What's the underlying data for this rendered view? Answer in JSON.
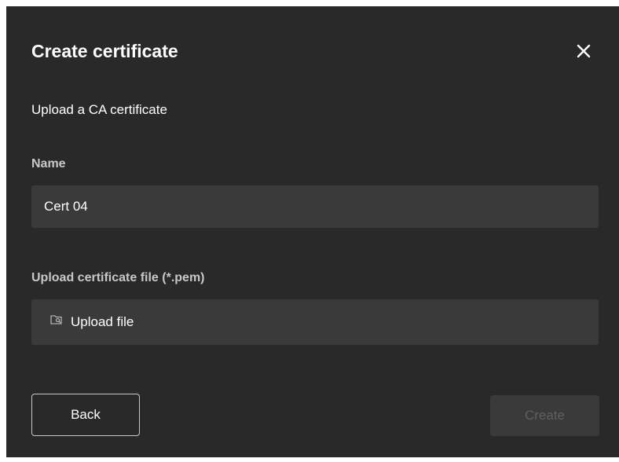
{
  "dialog": {
    "title": "Create certificate",
    "subtitle": "Upload a CA certificate",
    "close_icon": "close-icon"
  },
  "name_field": {
    "label": "Name",
    "value": "Cert 04"
  },
  "file_field": {
    "label": "Upload certificate file (*.pem)",
    "button_label": "Upload file",
    "icon": "folder-search-icon"
  },
  "actions": {
    "back_label": "Back",
    "create_label": "Create",
    "create_disabled": true
  },
  "colors": {
    "dialog_bg": "#292929",
    "input_bg": "#3a3a3a",
    "text": "#ffffff",
    "label_text": "#c8c8c8",
    "disabled_text": "#5f5f5f"
  }
}
